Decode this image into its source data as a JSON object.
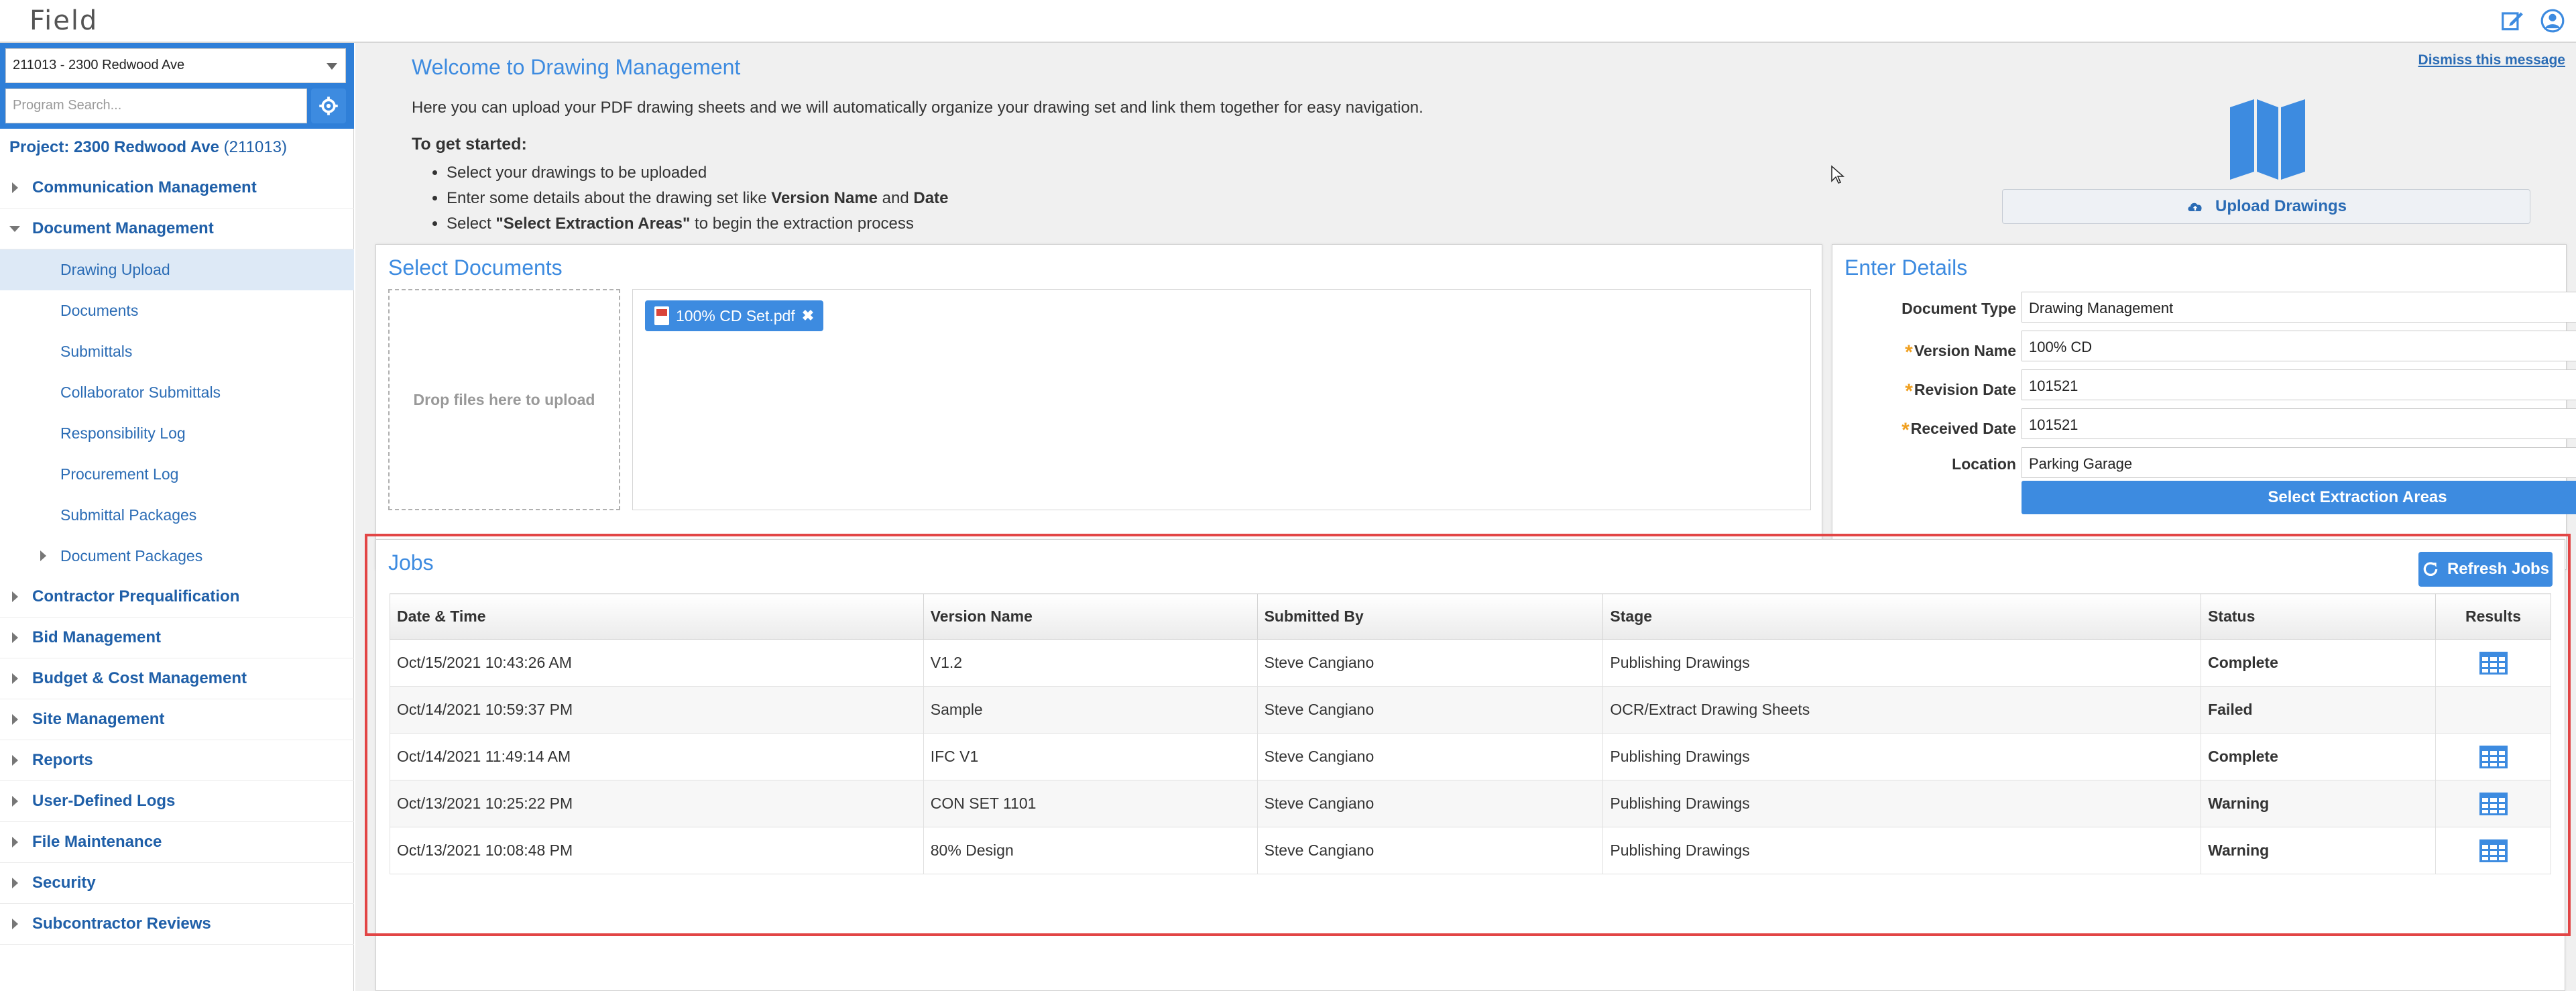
{
  "app": {
    "title": "Field"
  },
  "sidebar": {
    "project_select": "211013 - 2300 Redwood Ave",
    "search_placeholder": "Program Search...",
    "project_label": "Project: 2300 Redwood Ave",
    "project_code": "(211013)",
    "items": [
      {
        "label": "Communication Management",
        "expanded": false
      },
      {
        "label": "Document Management",
        "expanded": true,
        "children": [
          {
            "label": "Drawing Upload",
            "active": true
          },
          {
            "label": "Documents"
          },
          {
            "label": "Submittals"
          },
          {
            "label": "Collaborator Submittals"
          },
          {
            "label": "Responsibility Log"
          },
          {
            "label": "Procurement Log"
          },
          {
            "label": "Submittal Packages"
          },
          {
            "label": "Document Packages",
            "has_children": true
          }
        ]
      },
      {
        "label": "Contractor Prequalification"
      },
      {
        "label": "Bid Management"
      },
      {
        "label": "Budget & Cost Management"
      },
      {
        "label": "Site Management"
      },
      {
        "label": "Reports"
      },
      {
        "label": "User-Defined Logs"
      },
      {
        "label": "File Maintenance"
      },
      {
        "label": "Security"
      },
      {
        "label": "Subcontractor Reviews"
      }
    ]
  },
  "welcome": {
    "title": "Welcome to Drawing Management",
    "intro": "Here you can upload your PDF drawing sheets and we will automatically organize your drawing set and link them together for easy navigation.",
    "get_started": "To get started:",
    "step1": "Select your drawings to be uploaded",
    "step2_pre": "Enter some details about the drawing set like ",
    "step2_b1": "Version Name",
    "step2_mid": " and ",
    "step2_b2": "Date",
    "step3_pre": "Select ",
    "step3_b": "\"Select Extraction Areas\"",
    "step3_post": " to begin the extraction process",
    "dismiss": "Dismiss this message",
    "upload_button": "Upload Drawings"
  },
  "select_documents": {
    "title": "Select Documents",
    "drop_text": "Drop files here to upload",
    "file_name": "100% CD Set.pdf"
  },
  "enter_details": {
    "title": "Enter Details",
    "document_type_label": "Document Type",
    "document_type_value": "Drawing Management",
    "version_name_label": "Version Name",
    "version_name_value": "100% CD",
    "revision_date_label": "Revision Date",
    "revision_date_value": "101521",
    "received_date_label": "Received Date",
    "received_date_value": "101521",
    "location_label": "Location",
    "location_value": "Parking Garage",
    "extract_button": "Select Extraction Areas"
  },
  "jobs": {
    "title": "Jobs",
    "refresh_button": "Refresh Jobs",
    "columns": [
      "Date & Time",
      "Version Name",
      "Submitted By",
      "Stage",
      "Status",
      "Results"
    ],
    "rows": [
      {
        "date": "Oct/15/2021 10:43:26 AM",
        "version": "V1.2",
        "by": "Steve Cangiano",
        "stage": "Publishing Drawings",
        "status": "Complete",
        "has_result": true
      },
      {
        "date": "Oct/14/2021 10:59:37 PM",
        "version": "Sample",
        "by": "Steve Cangiano",
        "stage": "OCR/Extract Drawing Sheets",
        "status": "Failed",
        "has_result": false
      },
      {
        "date": "Oct/14/2021 11:49:14 AM",
        "version": "IFC V1",
        "by": "Steve Cangiano",
        "stage": "Publishing Drawings",
        "status": "Complete",
        "has_result": true
      },
      {
        "date": "Oct/13/2021 10:25:22 PM",
        "version": "CON SET 1101",
        "by": "Steve Cangiano",
        "stage": "Publishing Drawings",
        "status": "Warning",
        "has_result": true
      },
      {
        "date": "Oct/13/2021 10:08:48 PM",
        "version": "80% Design",
        "by": "Steve Cangiano",
        "stage": "Publishing Drawings",
        "status": "Warning",
        "has_result": true
      }
    ]
  },
  "colors": {
    "accent": "#3d8be0",
    "complete": "#3aa83a",
    "failed": "#e03a3a",
    "warning": "#ef8f1c",
    "highlight_outline": "#e24545"
  }
}
